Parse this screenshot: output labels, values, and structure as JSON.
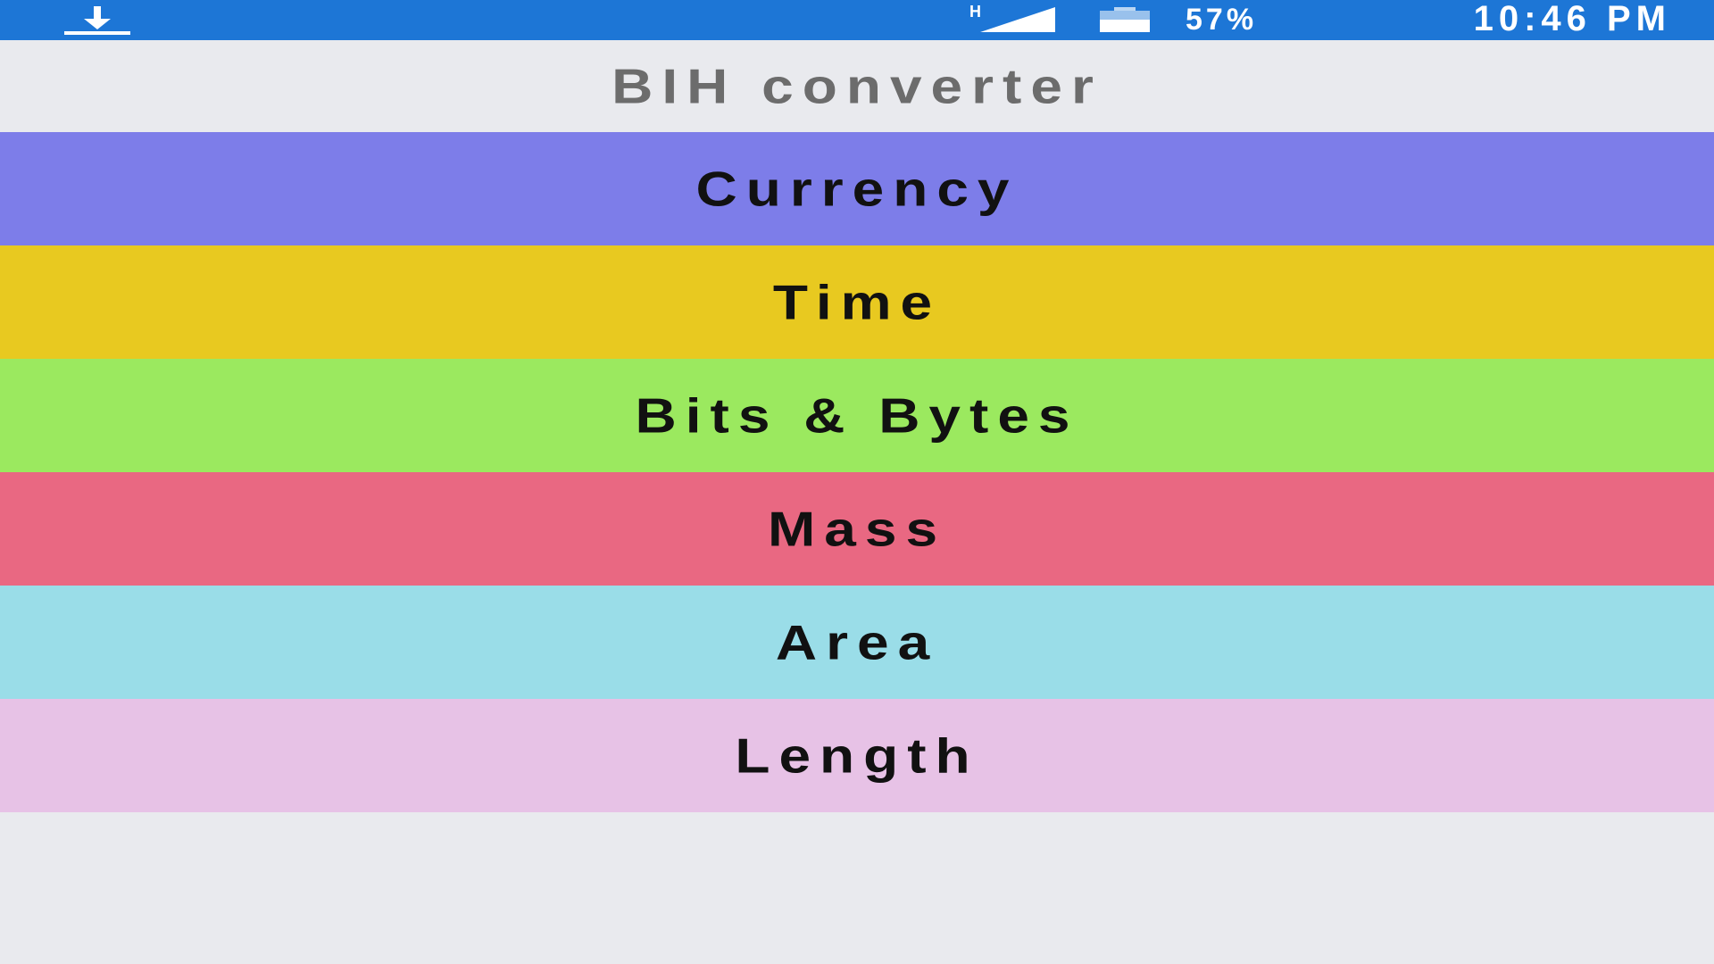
{
  "status_bar": {
    "download_icon": "download-icon",
    "network_type": "H",
    "signal_icon": "signal-icon",
    "battery_icon": "battery-icon",
    "battery_percent": "57%",
    "time": "10:46 PM",
    "background": "#1d76d6"
  },
  "app_bar": {
    "title": "BIH converter"
  },
  "menu": {
    "items": [
      {
        "label": "Currency",
        "color": "#7d7de9"
      },
      {
        "label": "Time",
        "color": "#e8c920"
      },
      {
        "label": "Bits & Bytes",
        "color": "#9be95f"
      },
      {
        "label": "Mass",
        "color": "#e96882"
      },
      {
        "label": "Area",
        "color": "#9adde8"
      },
      {
        "label": "Length",
        "color": "#e7c2e6"
      }
    ]
  }
}
